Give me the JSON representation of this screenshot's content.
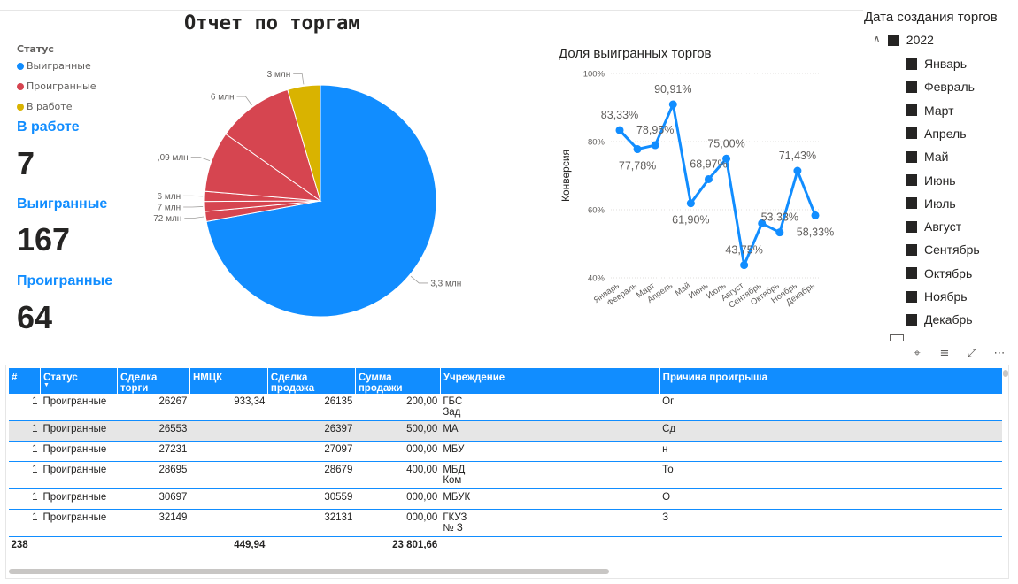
{
  "report_title": "Отчет по торгам",
  "status_legend": {
    "title": "Статус",
    "items": [
      {
        "label": "Выигранные",
        "color": "#118dff"
      },
      {
        "label": "Проигранные",
        "color": "#d64550"
      },
      {
        "label": "В работе",
        "color": "#d9b300"
      }
    ]
  },
  "kpis": [
    {
      "label": "В работе",
      "value": "7"
    },
    {
      "label": "Выигранные",
      "value": "167"
    },
    {
      "label": "Проигранные",
      "value": "64"
    }
  ],
  "chart_data": [
    {
      "type": "pie",
      "slices": [
        {
          "status": "Выигранные",
          "value": 72.5,
          "label": "3,3 млн",
          "color": "#118dff"
        },
        {
          "status": "Проигранные",
          "value": 1.4,
          "label": "72 млн",
          "color": "#d64550"
        },
        {
          "status": "Проигранные",
          "value": 1.4,
          "label": "7 млн",
          "color": "#d64550"
        },
        {
          "status": "Проигранные",
          "value": 1.4,
          "label": "6 млн",
          "color": "#d64550"
        },
        {
          "status": "Проигранные",
          "value": 8.5,
          "label": ",09 млн",
          "color": "#d64550"
        },
        {
          "status": "Проигранные",
          "value": 10.7,
          "label": "6 млн",
          "color": "#d64550"
        },
        {
          "status": "В работе",
          "value": 4.6,
          "label": "3 млн",
          "color": "#d9b300"
        }
      ]
    },
    {
      "type": "line",
      "title": "Доля выигранных торгов",
      "ylabel": "Конверсия",
      "categories": [
        "Январь",
        "Февраль",
        "Март",
        "Апрель",
        "Май",
        "Июнь",
        "Июль",
        "Август",
        "Сентябрь",
        "Октябрь",
        "Ноябрь",
        "Декабрь"
      ],
      "values": [
        83.33,
        77.78,
        78.95,
        90.91,
        61.9,
        68.97,
        75.0,
        43.75,
        56.0,
        53.33,
        71.43,
        58.33
      ],
      "labels": [
        "83,33%",
        "77,78%",
        "78,95%",
        "90,91%",
        "61,90%",
        "68,97%",
        "75,00%",
        "43,75%",
        "",
        "53,33%",
        "71,43%",
        "58,33%"
      ],
      "ylim": [
        40,
        100
      ],
      "yticks": [
        "40%",
        "60%",
        "80%",
        "100%"
      ],
      "color": "#118dff"
    }
  ],
  "slicer": {
    "title": "Дата создания торгов",
    "year": "2022",
    "months": [
      "Январь",
      "Февраль",
      "Март",
      "Апрель",
      "Май",
      "Июнь",
      "Июль",
      "Август",
      "Сентябрь",
      "Октябрь",
      "Ноябрь",
      "Декабрь"
    ]
  },
  "table": {
    "columns": [
      "#",
      "Статус",
      "Сделка торги",
      "НМЦК",
      "Сделка продажа",
      "Сумма продажи",
      "Учреждение",
      "Причина проигрыша"
    ],
    "rows": [
      {
        "n": "1",
        "status": "Проигранные",
        "deal": "26267",
        "nmck": "933,34",
        "sale_deal": "26135",
        "sum": "200,00",
        "org": "ГБС",
        "org2": "Зад",
        "reason": "Ог"
      },
      {
        "n": "1",
        "status": "Проигранные",
        "deal": "26553",
        "nmck": "",
        "sale_deal": "26397",
        "sum": "500,00",
        "org": "МА",
        "org2": "",
        "reason": "Сд"
      },
      {
        "n": "1",
        "status": "Проигранные",
        "deal": "27231",
        "nmck": "",
        "sale_deal": "27097",
        "sum": "000,00",
        "org": "МБУ",
        "org2": "",
        "reason": "н"
      },
      {
        "n": "1",
        "status": "Проигранные",
        "deal": "28695",
        "nmck": "",
        "sale_deal": "28679",
        "sum": "400,00",
        "org": "МБД",
        "org2": "Ком",
        "reason": "То"
      },
      {
        "n": "1",
        "status": "Проигранные",
        "deal": "30697",
        "nmck": "",
        "sale_deal": "30559",
        "sum": "000,00",
        "org": "МБУК",
        "org2": "",
        "reason": "О"
      },
      {
        "n": "1",
        "status": "Проигранные",
        "deal": "32149",
        "nmck": "",
        "sale_deal": "32131",
        "sum": "000,00",
        "org": "ГКУЗ",
        "org2": "№ З",
        "reason": "З"
      }
    ],
    "totals": {
      "n": "238",
      "nmck": "449,94",
      "sum": "23 801,66"
    }
  }
}
